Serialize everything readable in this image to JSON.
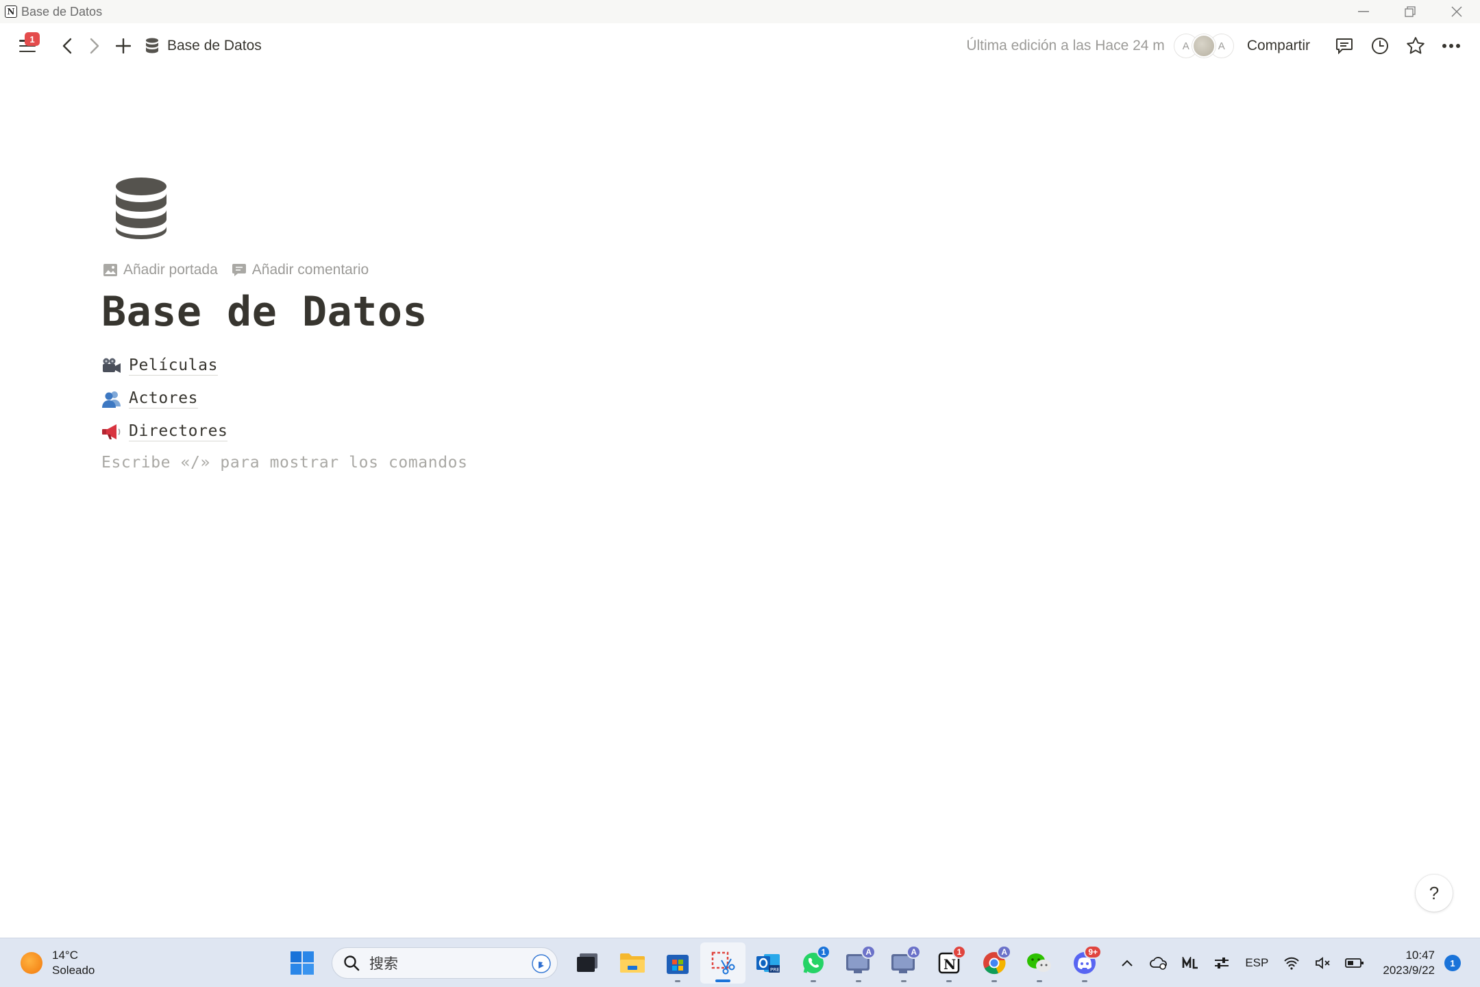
{
  "window": {
    "title": "Base de Datos",
    "app_icon_letter": "N"
  },
  "topbar": {
    "menu_badge": "1",
    "breadcrumb": "Base de Datos",
    "last_edited": "Última edición a las Hace 24 m",
    "avatars": [
      "A",
      "A"
    ],
    "share_label": "Compartir"
  },
  "page": {
    "title": "Base de Datos",
    "actions": {
      "add_cover": "Añadir portada",
      "add_comment": "Añadir comentario"
    },
    "links": [
      {
        "emoji_icon": "movie-camera-icon",
        "label": "Películas"
      },
      {
        "emoji_icon": "busts-in-silhouette-icon",
        "label": "Actores"
      },
      {
        "emoji_icon": "megaphone-icon",
        "label": "Directores"
      }
    ],
    "placeholder": "Escribe «/» para mostrar los comandos",
    "help_label": "?"
  },
  "taskbar": {
    "weather": {
      "temp": "14°C",
      "condition": "Soleado"
    },
    "search_placeholder": "搜索",
    "badges": {
      "whatsapp": "1",
      "teams1": "A",
      "teams2": "A",
      "notion": "1",
      "chrome": "A",
      "discord": "9+"
    },
    "tray": {
      "language": "ESP"
    },
    "clock": {
      "time": "10:47",
      "date": "2023/9/22"
    },
    "notifications": "1"
  },
  "colors": {
    "text": "#37352f",
    "muted": "#9b9a97",
    "badge_red": "#e44c4c",
    "accent_blue": "#1a73d9"
  }
}
